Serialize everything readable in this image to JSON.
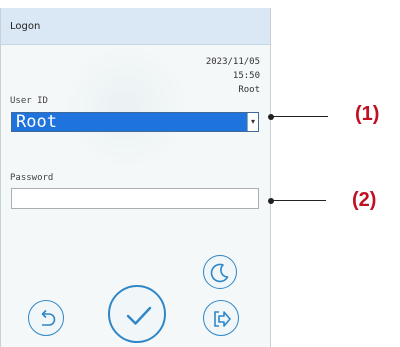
{
  "window": {
    "title": "Logon"
  },
  "status": {
    "date": "2023/11/05",
    "time": "15:50",
    "user": "Root"
  },
  "form": {
    "user_id_label": "User ID",
    "user_id_value": "Root",
    "password_label": "Password",
    "password_value": ""
  },
  "buttons": {
    "sleep_icon": "moon-icon",
    "back_icon": "undo-arrow-icon",
    "confirm_icon": "checkmark-icon",
    "logout_icon": "exit-arrow-icon"
  },
  "callouts": {
    "first": "(1)",
    "second": "(2)"
  },
  "colors": {
    "header": "#d9e8f4",
    "selection": "#1e73dc",
    "accent": "#2f87c8",
    "callout": "#c01022"
  }
}
